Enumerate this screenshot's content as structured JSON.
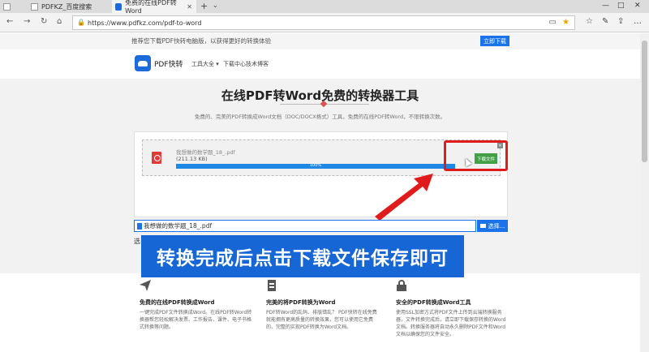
{
  "browser": {
    "tabs": [
      {
        "label": ""
      },
      {
        "label": "PDFKZ_百度搜索"
      },
      {
        "label": "免费的在线PDF转Word"
      }
    ],
    "url": "https://www.pdfkz.com/pdf-to-word"
  },
  "page": {
    "banner_text": "推荐您下载PDF快转电脑版，以获得更好的转换体验",
    "banner_button": "立即下载",
    "logo_text": "PDF快转",
    "nav": [
      "工具大全 ▾",
      "下载中心",
      "技术博客"
    ],
    "title": "在线PDF转Word免费的转换器工具",
    "subtitle": "免费的、完美的PDF转换成Word文档（DOC/DOCX格式）工具，免费的在线PDF转Word，不限转换次数。",
    "upload": {
      "file_name": "我想做的数学题_18_.pdf",
      "file_size": "(211.13 KB)",
      "progress_text": "100%",
      "progress_pct": 100,
      "download_button": "下载文件",
      "close": "✕"
    },
    "file_input_value": "我想做的数学题_18_.pdf",
    "choose_button": "选择...",
    "select_label": "选",
    "overlay_text": "转换完成后点击下载文件保存即可",
    "features": [
      {
        "title": "免费的在线PDF转换成Word",
        "desc": "一键完成PDF文件转换成Word。在线PDF转Word转换器帮您轻松解决发票、工作报告、课件、电子书格式转换等问题。"
      },
      {
        "title": "完美的将PDF转换为Word",
        "desc": "PDF转Word的乱码、排版错乱？ PDF快转在线免费就能拥有更高质量的转换效果，您可以使用它免费的、完整的实现PDF转换为Word文档。"
      },
      {
        "title": "安全的PDF转换成Word工具",
        "desc": "使用SSL加密方式将PDF文件上传到云端转换服务器，文件转换完成后，请立即下载保存转换的Word文档。转换服务器将自动永久删除PDF文件和Word文档以确保您的文件安全。"
      }
    ]
  },
  "colors": {
    "accent": "#1a73e8",
    "highlight": "#e01b1b",
    "download": "#43a047"
  }
}
